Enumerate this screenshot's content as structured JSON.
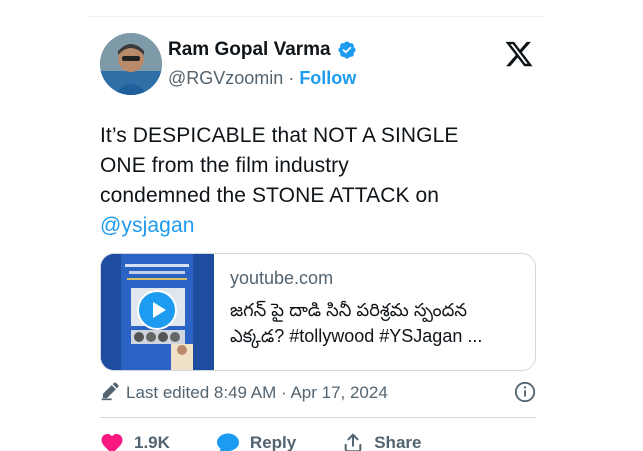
{
  "author": {
    "name": "Ram Gopal Varma",
    "handle": "@RGVzoomin",
    "separator": "·",
    "follow_label": "Follow"
  },
  "tweet": {
    "lines": [
      "It’s DESPICABLE that NOT A SINGLE",
      "ONE from the film industry",
      "condemned the STONE ATTACK on"
    ],
    "mention": "@ysjagan"
  },
  "link_card": {
    "domain": "youtube.com",
    "title_line1": "జగన్ పై దాడి సినీ పరిశ్రమ స్పందన",
    "title_line2": "ఎక్కడ? #tollywood #YSJagan ..."
  },
  "meta": {
    "edited": "Last edited 8:49 AM · Apr 17, 2024"
  },
  "actions": {
    "likes": "1.9K",
    "reply_label": "Reply",
    "share_label": "Share"
  },
  "colors": {
    "accent": "#1d9bf0",
    "like": "#f91880",
    "secondary_text": "#536471"
  },
  "icons": [
    "verified-badge-icon",
    "x-logo-icon",
    "play-icon",
    "pencil-icon",
    "info-icon",
    "heart-icon",
    "reply-bubble-icon",
    "share-icon"
  ]
}
